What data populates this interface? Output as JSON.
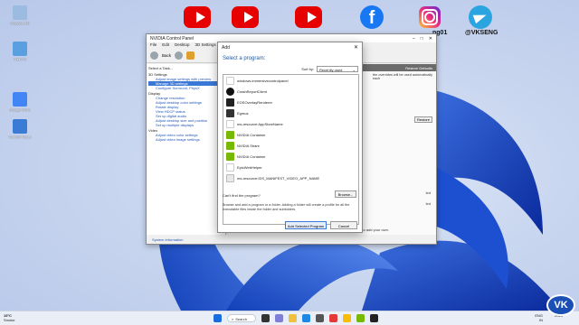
{
  "desktop": {
    "icons": [
      {
        "label": "Recycle Bin",
        "color": "#9bbbe0"
      },
      {
        "label": "This PC",
        "color": "#5aa0e0"
      },
      {
        "label": "Google Drive",
        "color": "#4285f4"
      },
      {
        "label": "Control Panel",
        "color": "#3a7bd5"
      }
    ]
  },
  "social": {
    "facebook_handle": "ng01",
    "telegram_handle": "@VKSENG"
  },
  "ncp": {
    "title": "NVIDIA Control Panel",
    "menu": [
      "File",
      "Edit",
      "Desktop",
      "3D Settings",
      "Help"
    ],
    "toolbar": {
      "back": "Back"
    },
    "select_task": "Select a Task...",
    "tree": [
      {
        "group": "3D Settings",
        "items": [
          "Adjust image settings with preview",
          "Manage 3D settings",
          "Configure Surround, PhysX"
        ]
      },
      {
        "group": "Display",
        "items": [
          "Change resolution",
          "Adjust desktop color settings",
          "Rotate display",
          "View HDCP status",
          "Set up digital audio",
          "Adjust desktop size and position",
          "Set up multiple displays"
        ]
      },
      {
        "group": "Video",
        "items": [
          "Adjust video color settings",
          "Adjust video image settings"
        ]
      }
    ],
    "selected_item": "Manage 3D settings",
    "restore_defaults": "Restore Defaults",
    "override_text": "the overrides will be used automatically each",
    "restore_button": "Restore",
    "side_labels": [
      "led",
      "led"
    ],
    "description_title": "Description:",
    "description_text": "If NVIDIA has not provided settings for a program on your system, click the button to add your own.",
    "system_information": "System Information"
  },
  "dialog": {
    "title": "Add",
    "close": "✕",
    "heading": "Select a program:",
    "sort_label": "Sort by:",
    "sort_value": "Recently used",
    "programs": [
      {
        "name": "windows.immersivecontrolpanel",
        "icon": "blank"
      },
      {
        "name": "CrashReportClient",
        "icon": "ue"
      },
      {
        "name": "EOSOverlayRenderer",
        "icon": "eos"
      },
      {
        "name": "Egmus",
        "icon": "egmus"
      },
      {
        "name": "ms-resource:AppStoreName",
        "icon": "blank"
      },
      {
        "name": "NVIDIA Container",
        "icon": "nv"
      },
      {
        "name": "NVIDIA Share",
        "icon": "nv"
      },
      {
        "name": "NVIDIA Container",
        "icon": "nv"
      },
      {
        "name": "EpicWebHelper",
        "icon": "blank"
      },
      {
        "name": "ms-resource:IDS_MANIFEST_VIDEO_APP_NAME",
        "icon": "ms"
      }
    ],
    "cant_find": "Can't find the program?",
    "browse": "Browse...",
    "help": "Browse and add a program or a folder. Adding a folder will create a profile for all the executable files inside the folder and subfolders.",
    "add_button": "Add Selected Program",
    "cancel_button": "Cancel"
  },
  "taskbar": {
    "temp": "19°C",
    "condition": "Smoke",
    "search": "Search",
    "lang": "ENG",
    "lang2": "IN",
    "time": "",
    "date": "2023"
  },
  "colors": {
    "accent": "#3a78d8",
    "nvidia_green": "#76b900",
    "youtube_red": "#e60000"
  }
}
